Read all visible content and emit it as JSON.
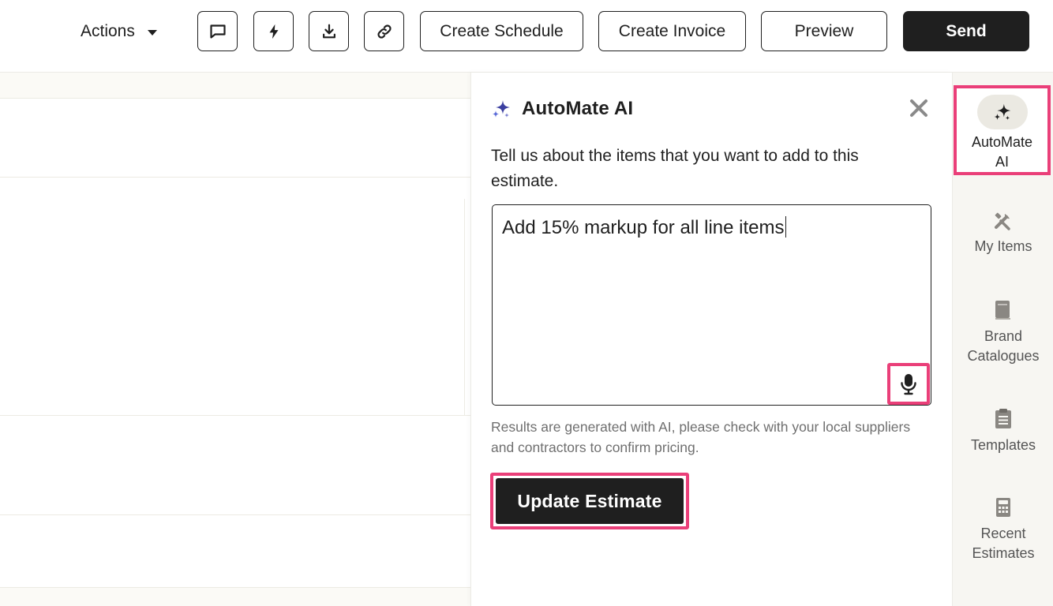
{
  "toolbar": {
    "actions_label": "Actions",
    "icon_buttons": [
      "comment-icon",
      "bolt-icon",
      "download-icon",
      "link-icon"
    ],
    "create_schedule_label": "Create Schedule",
    "create_invoice_label": "Create Invoice",
    "preview_label": "Preview",
    "send_label": "Send"
  },
  "ai_panel": {
    "title": "AutoMate AI",
    "description": "Tell us about the items that you want to add to this estimate.",
    "prompt_value": "Add 15% markup for all line items",
    "disclaimer": "Results are generated with AI, please check with your local suppliers and contractors to confirm pricing.",
    "update_button_label": "Update Estimate"
  },
  "sidebar": {
    "items": [
      {
        "label": "AutoMate AI",
        "icon": "sparkle-icon",
        "active": true
      },
      {
        "label": "My Items",
        "icon": "tools-icon",
        "active": false
      },
      {
        "label": "Brand Catalogues",
        "icon": "book-icon",
        "active": false
      },
      {
        "label": "Templates",
        "icon": "clipboard-icon",
        "active": false
      },
      {
        "label": "Recent Estimates",
        "icon": "calculator-icon",
        "active": false
      }
    ]
  },
  "colors": {
    "primary_dark": "#1f1f1f",
    "highlight": "#ea3f79",
    "sparkle_accent": "#3b3fa0",
    "sidebar_bg": "#f7f6f2",
    "muted_text": "#6f6f6f"
  }
}
